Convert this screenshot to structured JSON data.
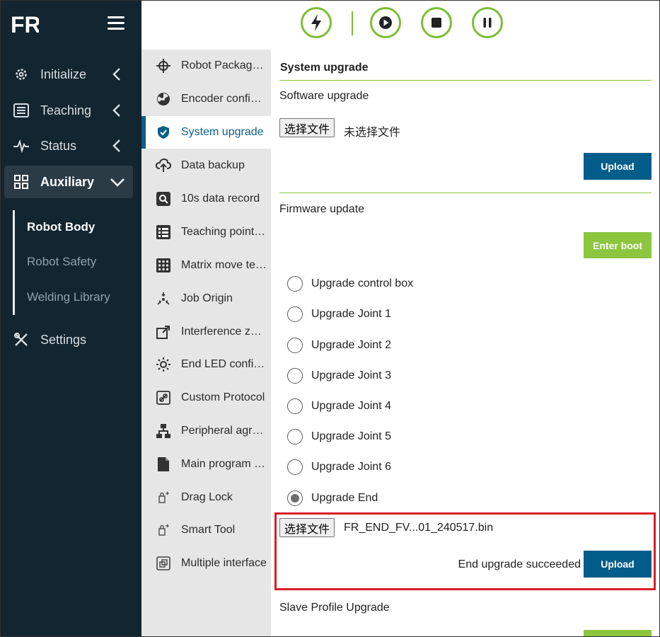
{
  "app": {
    "logo_text": "FR"
  },
  "sidebar": {
    "items": [
      {
        "label": "Initialize",
        "icon": "gear-icon"
      },
      {
        "label": "Teaching",
        "icon": "list-icon"
      },
      {
        "label": "Status",
        "icon": "pulse-icon"
      },
      {
        "label": "Auxiliary",
        "icon": "grid-icon"
      },
      {
        "label": "Settings",
        "icon": "tools-icon"
      }
    ],
    "sub_items": [
      {
        "label": "Robot Body"
      },
      {
        "label": "Robot Safety"
      },
      {
        "label": "Welding Library"
      }
    ]
  },
  "toolbar": {
    "icons": [
      "lightning-icon",
      "play-icon",
      "stop-icon",
      "pause-icon"
    ]
  },
  "menu": {
    "items": [
      {
        "label": "Robot Package upgrade"
      },
      {
        "label": "Encoder configuration"
      },
      {
        "label": "System upgrade"
      },
      {
        "label": "Data backup"
      },
      {
        "label": "10s data record"
      },
      {
        "label": "Teaching point import"
      },
      {
        "label": "Matrix move teaching"
      },
      {
        "label": "Job Origin"
      },
      {
        "label": "Interference zone"
      },
      {
        "label": "End LED configuration"
      },
      {
        "label": "Custom Protocol"
      },
      {
        "label": "Peripheral agreement"
      },
      {
        "label": "Main program setting"
      },
      {
        "label": "Drag Lock"
      },
      {
        "label": "Smart Tool"
      },
      {
        "label": "Multiple interface"
      }
    ]
  },
  "main": {
    "title": "System upgrade",
    "software": {
      "label": "Software upgrade",
      "choose_file": "选择文件",
      "file_name": "未选择文件",
      "upload": "Upload"
    },
    "firmware": {
      "label": "Firmware update",
      "enter_boot": "Enter boot",
      "options": [
        "Upgrade control box",
        "Upgrade Joint 1",
        "Upgrade Joint 2",
        "Upgrade Joint 3",
        "Upgrade Joint 4",
        "Upgrade Joint 5",
        "Upgrade Joint 6",
        "Upgrade End"
      ],
      "selected": "Upgrade End",
      "choose_file": "选择文件",
      "file_name": "FR_END_FV...01_240517.bin",
      "status": "End upgrade succeeded",
      "upload": "Upload"
    },
    "slave": {
      "label": "Slave Profile Upgrade"
    }
  },
  "colors": {
    "sidebar_bg": "#122530",
    "accent_green": "#8cc63f",
    "accent_blue": "#035d8a",
    "highlight_red": "#d91f26"
  }
}
